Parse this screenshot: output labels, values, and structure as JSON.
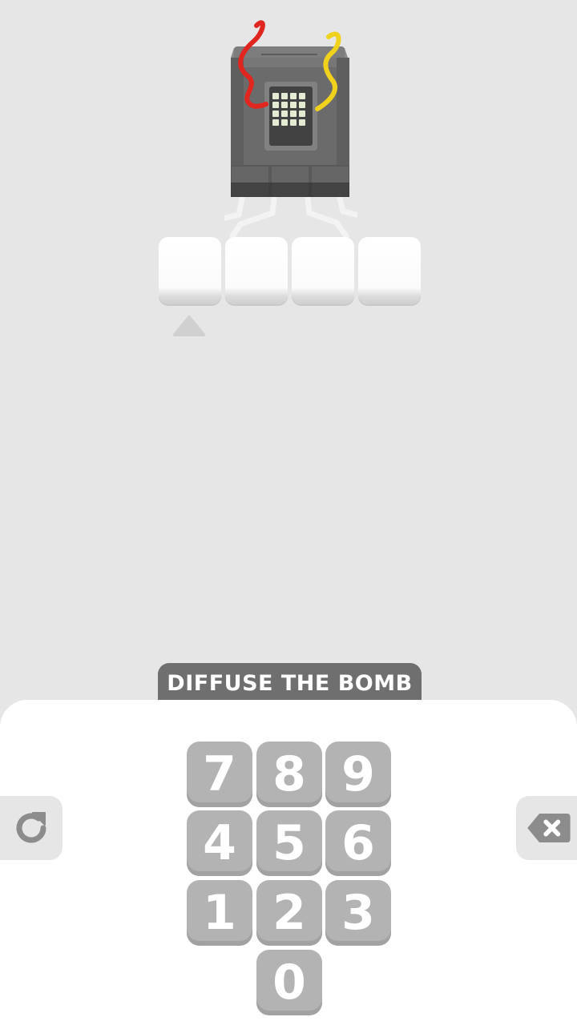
{
  "instruction": "DIFFUSE THE BOMB",
  "keypad": {
    "keys": [
      "7",
      "8",
      "9",
      "4",
      "5",
      "6",
      "1",
      "2",
      "3",
      "0"
    ]
  },
  "code_slots": [
    "",
    "",
    "",
    ""
  ],
  "icons": {
    "reset": "reset-icon",
    "backspace": "backspace-icon",
    "pointer": "slot-pointer-icon"
  },
  "colors": {
    "background": "#e6e6e6",
    "key": "#b3b3b3",
    "banner": "#6f6f6f",
    "wire_red": "#e0261f",
    "wire_yellow": "#f0d21c",
    "bomb_body": "#6b6b6b"
  }
}
